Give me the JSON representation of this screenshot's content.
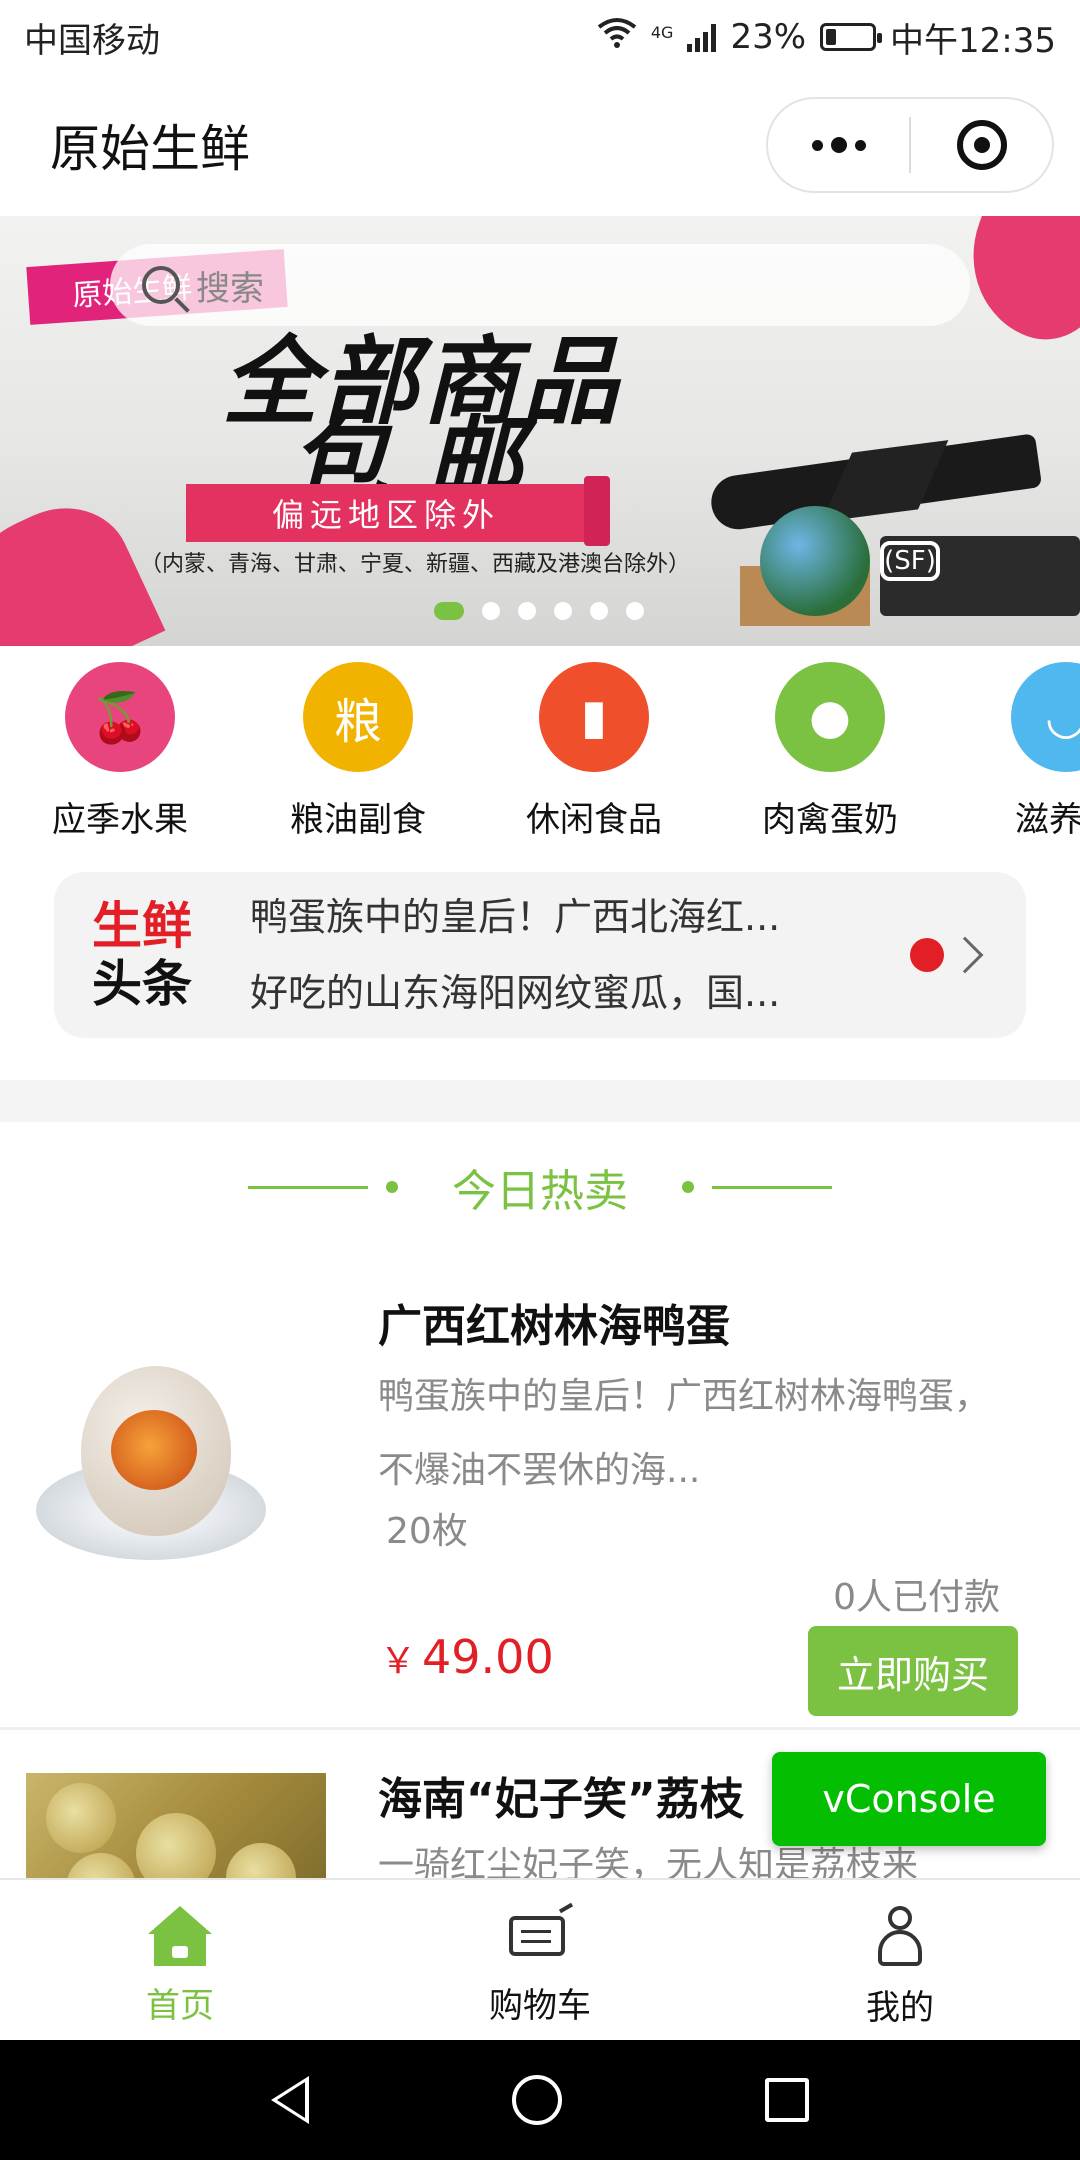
{
  "status": {
    "carrier": "中国移动",
    "network": "4G",
    "battery": "23%",
    "time": "中午12:35"
  },
  "header": {
    "title": "原始生鲜"
  },
  "banner": {
    "tag": "原始生鲜",
    "search_placeholder": "搜索",
    "headline1": "全部商品",
    "headline2": "包邮",
    "stripe": "偏远地区除外",
    "note": "（内蒙、青海、甘肃、宁夏、新疆、西藏及港澳台除外）",
    "sf_logo": "(SF)",
    "slides_total": 6,
    "slide_active": 1
  },
  "categories": [
    {
      "label": "应季水果",
      "icon": "cherry-icon",
      "color": "#e8447e"
    },
    {
      "label": "粮油副食",
      "icon": "oil-icon",
      "color": "#f2b300"
    },
    {
      "label": "休闲食品",
      "icon": "fries-icon",
      "color": "#ef4f2a"
    },
    {
      "label": "肉禽蛋奶",
      "icon": "chicken-icon",
      "color": "#7cc242"
    },
    {
      "label": "滋养健",
      "icon": "bowl-icon",
      "color": "#4fb8ee"
    }
  ],
  "news": {
    "logo_line1": "生鲜",
    "logo_line2": "头条",
    "items": [
      "鸭蛋族中的皇后！广西北海红...",
      "好吃的山东海阳网纹蜜瓜，国..."
    ]
  },
  "section": {
    "title": "今日热卖"
  },
  "products": [
    {
      "name": "广西红树林海鸭蛋",
      "desc": "鸭蛋族中的皇后！广西红树林海鸭蛋，不爆油不罢休的海...",
      "spec": "20枚",
      "paid": "0人已付款",
      "currency": "￥",
      "price": "49.00",
      "buy": "立即购买"
    },
    {
      "name": "海南“妃子笑”荔枝",
      "desc": "一骑红尘妃子笑，无人知是荔枝来"
    }
  ],
  "vconsole": "vConsole",
  "tabbar": [
    {
      "label": "首页",
      "icon": "home-icon",
      "active": true
    },
    {
      "label": "购物车",
      "icon": "cart-icon",
      "active": false
    },
    {
      "label": "我的",
      "icon": "user-icon",
      "active": false
    }
  ],
  "colors": {
    "accent": "#7bc142",
    "price": "#e21f26",
    "vconsole": "#04be02"
  }
}
